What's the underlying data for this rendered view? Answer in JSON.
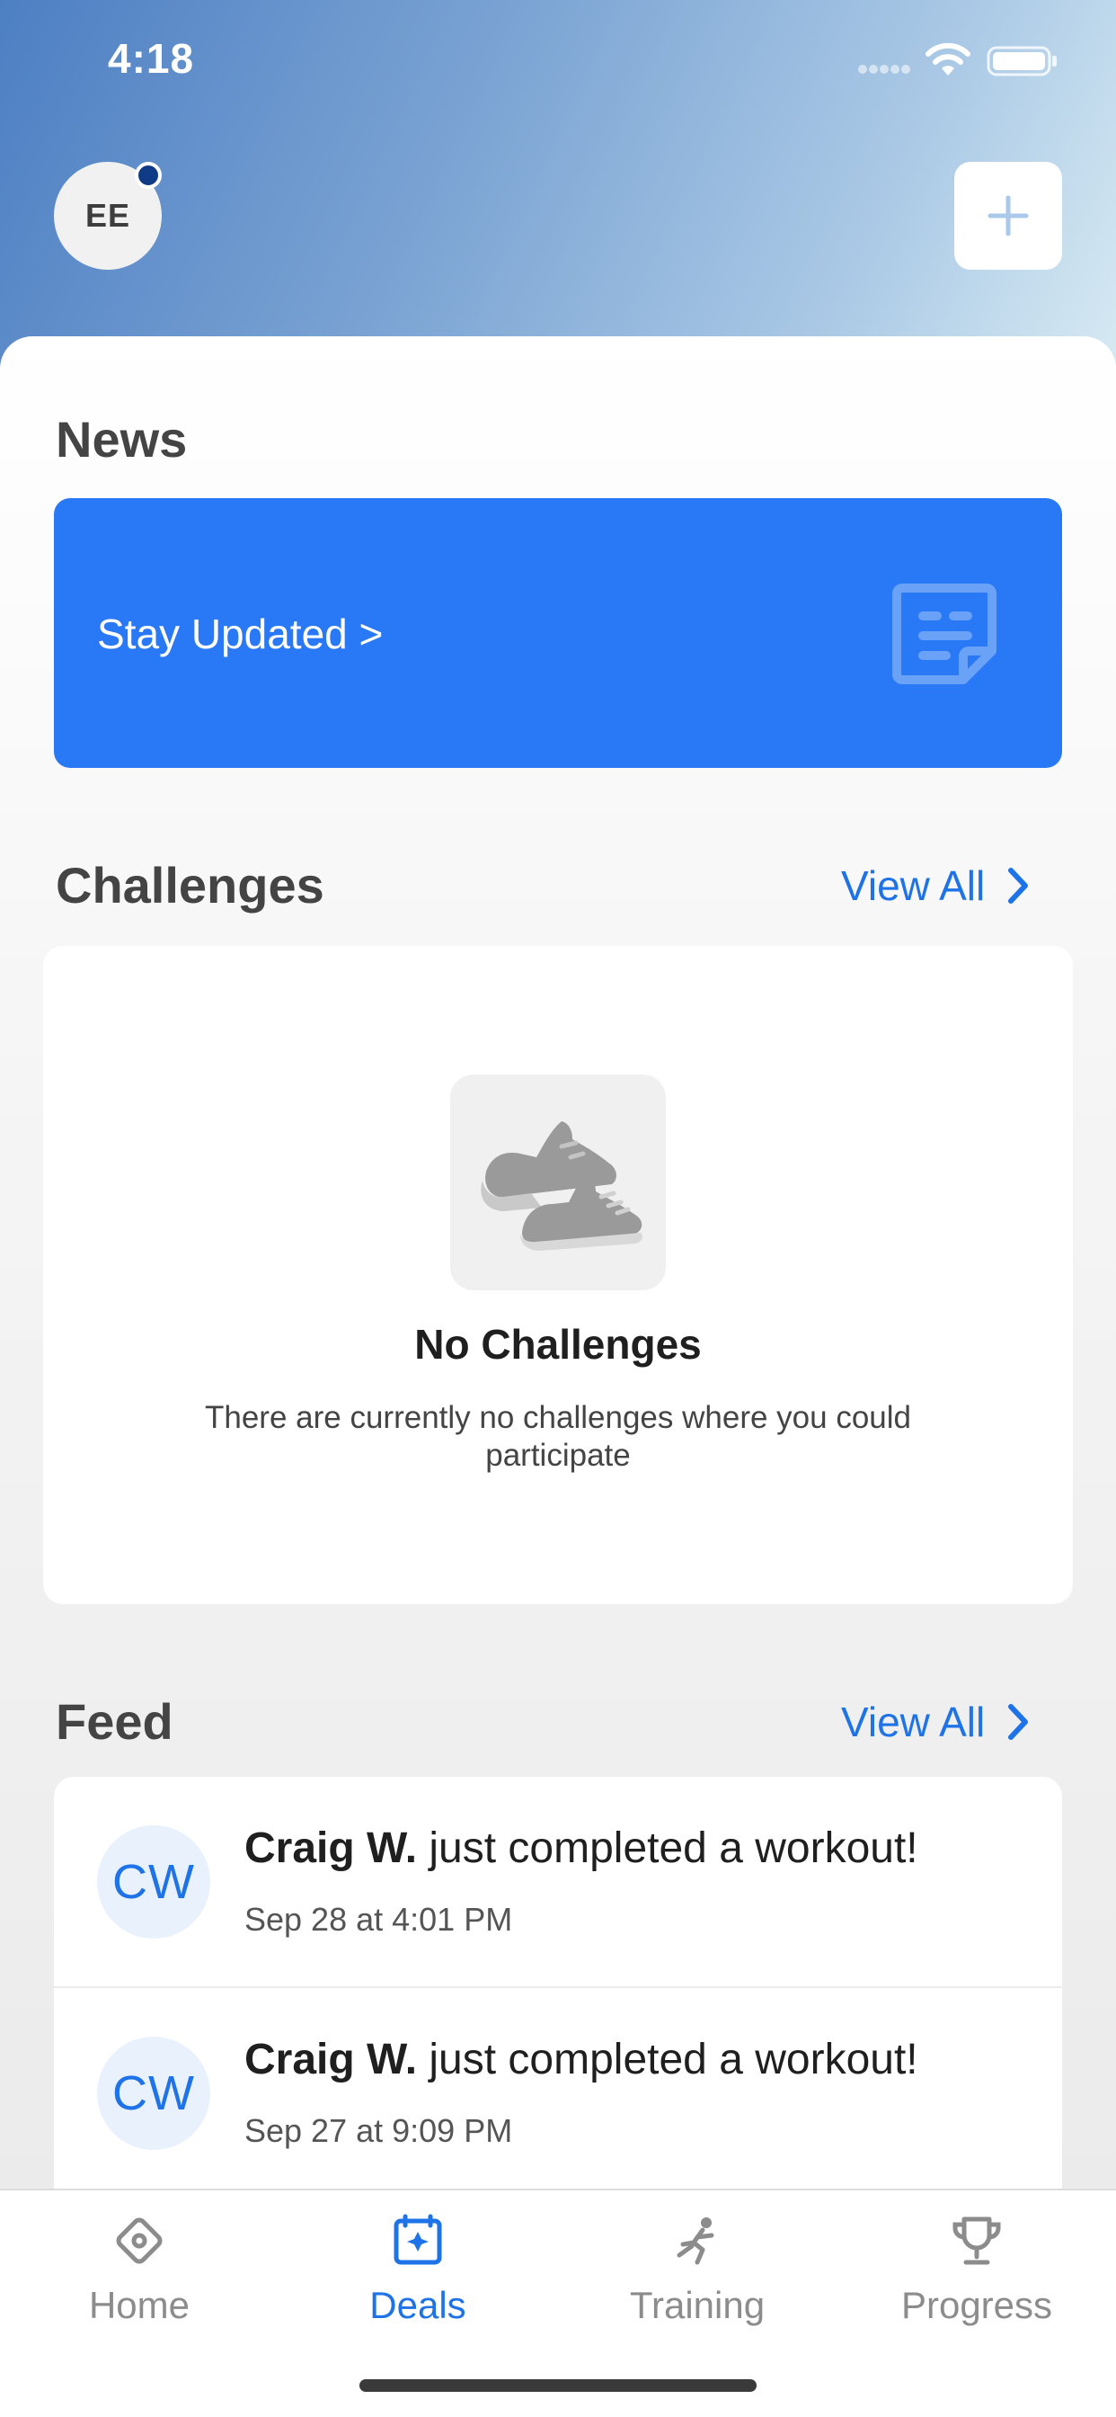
{
  "status_bar": {
    "time": "4:18"
  },
  "header": {
    "avatar_initials": "EE",
    "add_icon": "plus-icon"
  },
  "news": {
    "title": "News",
    "card_label": "Stay Updated >",
    "card_icon": "document-icon",
    "card_color": "#2978f5"
  },
  "challenges": {
    "title": "Challenges",
    "view_all": "View All",
    "empty_title": "No Challenges",
    "empty_description": "There are currently no challenges where you could participate",
    "empty_icon": "sneakers-icon"
  },
  "feed": {
    "title": "Feed",
    "view_all": "View All",
    "items": [
      {
        "initials": "CW",
        "name": "Craig W.",
        "message": " just completed a workout!",
        "time": "Sep 28 at 4:01 PM"
      },
      {
        "initials": "CW",
        "name": "Craig W.",
        "message": " just completed a workout!",
        "time": "Sep 27 at 9:09 PM"
      }
    ]
  },
  "tab_bar": {
    "tabs": [
      {
        "label": "Home",
        "icon": "home-diamond-icon"
      },
      {
        "label": "Deals",
        "icon": "deals-icon"
      },
      {
        "label": "Training",
        "icon": "running-figure-icon"
      },
      {
        "label": "Progress",
        "icon": "trophy-icon"
      }
    ],
    "active_tab": "Deals",
    "accent_color": "#1f73e8"
  }
}
